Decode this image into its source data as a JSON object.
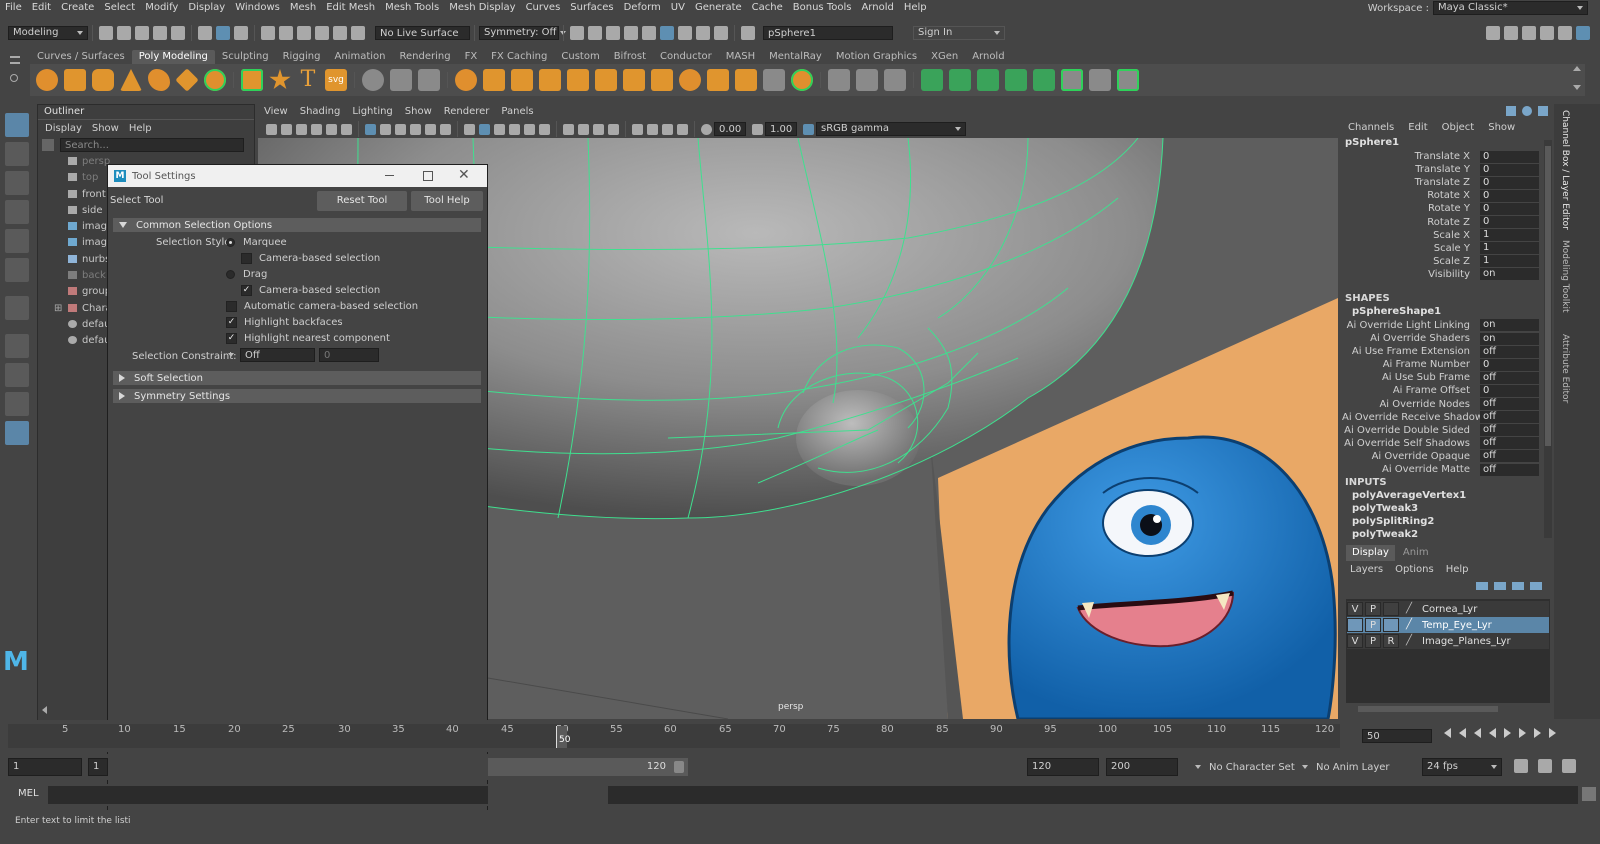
{
  "menubar": {
    "items": [
      "File",
      "Edit",
      "Create",
      "Select",
      "Modify",
      "Display",
      "Windows",
      "Mesh",
      "Edit Mesh",
      "Mesh Tools",
      "Mesh Display",
      "Curves",
      "Surfaces",
      "Deform",
      "UV",
      "Generate",
      "Cache",
      "Bonus Tools",
      "Arnold",
      "Help"
    ],
    "workspace_label": "Workspace :",
    "workspace_value": "Maya Classic*"
  },
  "status_line": {
    "mode": "Modeling",
    "live_surface": "No Live Surface",
    "symmetry": "Symmetry: Off",
    "object_name": "pSphere1",
    "sign_in": "Sign In"
  },
  "shelf": {
    "tabs": [
      "Curves / Surfaces",
      "Poly Modeling",
      "Sculpting",
      "Rigging",
      "Animation",
      "Rendering",
      "FX",
      "FX Caching",
      "Custom",
      "Bifrost",
      "Conductor",
      "MASH",
      "MentalRay",
      "Motion Graphics",
      "XGen",
      "Arnold"
    ],
    "active_tab": "Poly Modeling",
    "text_icon": "T",
    "svg_icon": "svg"
  },
  "outliner": {
    "title": "Outliner",
    "menu": [
      "Display",
      "Show",
      "Help"
    ],
    "search_placeholder": "Search...",
    "items": [
      {
        "label": "persp",
        "dim": true
      },
      {
        "label": "top",
        "dim": true
      },
      {
        "label": "front",
        "dim": false
      },
      {
        "label": "side",
        "dim": false
      },
      {
        "label": "image",
        "dim": false
      },
      {
        "label": "image",
        "dim": false
      },
      {
        "label": "nurbs",
        "dim": false
      },
      {
        "label": "back",
        "dim": true
      },
      {
        "label": "group",
        "dim": false
      },
      {
        "label": "Chara",
        "dim": false
      },
      {
        "label": "defau",
        "dim": false
      },
      {
        "label": "defau",
        "dim": false
      }
    ]
  },
  "viewport": {
    "menu": [
      "View",
      "Shading",
      "Lighting",
      "Show",
      "Renderer",
      "Panels"
    ],
    "exposure": "0.00",
    "gamma": "1.00",
    "color_space": "sRGB gamma",
    "camera_label": "persp"
  },
  "tool_settings": {
    "title": "Tool Settings",
    "tool_name": "Select Tool",
    "reset_button": "Reset Tool",
    "help_button": "Tool Help",
    "common_section": "Common Selection Options",
    "selection_style_label": "Selection Style:",
    "marquee": "Marquee",
    "camera_based_1": "Camera-based selection",
    "drag": "Drag",
    "camera_based_2": "Camera-based selection",
    "auto_camera": "Automatic camera-based selection",
    "highlight_backfaces": "Highlight backfaces",
    "highlight_nearest": "Highlight nearest component",
    "constraint_label": "Selection Constraint:",
    "constraint_value": "Off",
    "constraint_num": "0",
    "soft_selection": "Soft Selection",
    "symmetry_settings": "Symmetry Settings",
    "checks": {
      "camera_based_1": false,
      "camera_based_2": true,
      "auto_camera": false,
      "highlight_backfaces": true,
      "highlight_nearest": true
    },
    "marquee_selected": true
  },
  "channel_box": {
    "menu": [
      "Channels",
      "Edit",
      "Object",
      "Show"
    ],
    "object": "pSphere1",
    "channels": [
      {
        "name": "Translate X",
        "value": "0"
      },
      {
        "name": "Translate Y",
        "value": "0"
      },
      {
        "name": "Translate Z",
        "value": "0"
      },
      {
        "name": "Rotate X",
        "value": "0"
      },
      {
        "name": "Rotate Y",
        "value": "0"
      },
      {
        "name": "Rotate Z",
        "value": "0"
      },
      {
        "name": "Scale X",
        "value": "1"
      },
      {
        "name": "Scale Y",
        "value": "1"
      },
      {
        "name": "Scale Z",
        "value": "1"
      },
      {
        "name": "Visibility",
        "value": "on"
      }
    ],
    "shapes_header": "SHAPES",
    "shape_name": "pSphereShape1",
    "shape_attrs": [
      {
        "name": "Ai Override Light Linking",
        "value": "on"
      },
      {
        "name": "Ai Override Shaders",
        "value": "on"
      },
      {
        "name": "Ai Use Frame Extension",
        "value": "off"
      },
      {
        "name": "Ai Frame Number",
        "value": "0"
      },
      {
        "name": "Ai Use Sub Frame",
        "value": "off"
      },
      {
        "name": "Ai Frame Offset",
        "value": "0"
      },
      {
        "name": "Ai Override Nodes",
        "value": "off"
      },
      {
        "name": "Ai Override Receive Shadows",
        "value": "off"
      },
      {
        "name": "Ai Override Double Sided",
        "value": "off"
      },
      {
        "name": "Ai Override Self Shadows",
        "value": "off"
      },
      {
        "name": "Ai Override Opaque",
        "value": "off"
      },
      {
        "name": "Ai Override Matte",
        "value": "off"
      }
    ],
    "inputs_header": "INPUTS",
    "inputs": [
      "polyAverageVertex1",
      "polyTweak3",
      "polySplitRing2",
      "polyTweak2"
    ]
  },
  "layer_editor": {
    "tabs": [
      "Display",
      "Anim"
    ],
    "menu": [
      "Layers",
      "Options",
      "Help"
    ],
    "layers": [
      {
        "v": "V",
        "p": "P",
        "r": "",
        "name": "Cornea_Lyr",
        "selected": false
      },
      {
        "v": "",
        "p": "P",
        "r": "",
        "name": "Temp_Eye_Lyr",
        "selected": true
      },
      {
        "v": "V",
        "p": "P",
        "r": "R",
        "name": "Image_Planes_Lyr",
        "selected": false
      }
    ]
  },
  "side_tabs": [
    "Channel Box / Layer Editor",
    "Modeling Toolkit",
    "Attribute Editor"
  ],
  "timeline": {
    "ticks": [
      "5",
      "10",
      "15",
      "20",
      "25",
      "30",
      "35",
      "40",
      "45",
      "50",
      "55",
      "60",
      "65",
      "70",
      "75",
      "80",
      "85",
      "90",
      "95",
      "100",
      "105",
      "110",
      "115",
      "120"
    ],
    "current_frame": "50",
    "current_frame_field": "50"
  },
  "range": {
    "start": "1",
    "start2": "1",
    "range_end": "120",
    "end": "120",
    "anim_end": "200",
    "character_set": "No Character Set",
    "anim_layer": "No Anim Layer",
    "fps": "24 fps"
  },
  "command_line": {
    "label": "MEL"
  },
  "help_line": {
    "text": "Enter text to limit the listi"
  },
  "colors": {
    "wireframe": "#3fe08f",
    "monster_blue": "#1c78c8",
    "backdrop": "#e9a866",
    "selection": "#5b86a8"
  }
}
